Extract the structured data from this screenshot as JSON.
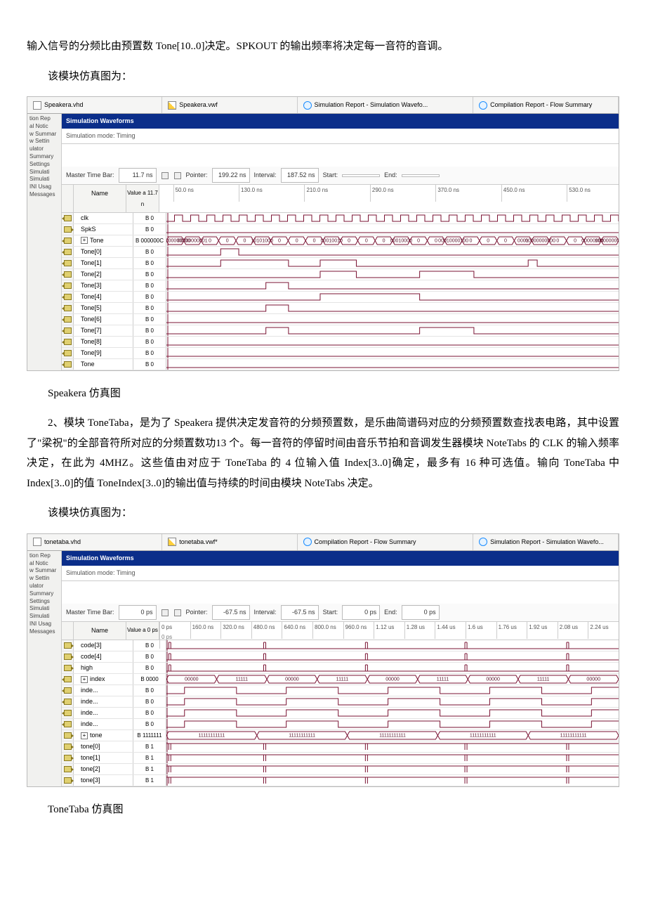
{
  "para1": "输入信号的分频比由预置数 Tone[10..0]决定。SPKOUT 的输出频率将决定每一音符的音调。",
  "para2": "该模块仿真图为：",
  "caption1": "Speakera 仿真图",
  "para3": "2、模块 ToneTaba，是为了 Speakera 提供决定发音符的分频预置数，是乐曲简谱码对应的分频预置数查找表电路，其中设置了\"梁祝\"的全部音符所对应的分频置数功13 个。每一音符的停留时间由音乐节拍和音调发生器模块 NoteTabs 的 CLK 的输入频率决定，在此为 4MHZ。这些值由对应于 ToneTaba 的 4 位输入值 Index[3..0]确定，最多有 16 种可选值。输向 ToneTaba 中 Index[3..0]的值 ToneIndex[3..0]的输出值与持续的时间由模块 NoteTabs 决定。",
  "para4": "该模块仿真图为：",
  "caption2": "ToneTaba 仿真图",
  "sim1": {
    "tabs": [
      "Speakera.vhd",
      "Speakera.vwf",
      "Simulation Report - Simulation Wavefo...",
      "Compilation Report - Flow Summary"
    ],
    "title": "Simulation Waveforms",
    "mode": "Simulation mode: Timing",
    "left": [
      "tion Rep",
      "al Notic",
      "w Summar",
      "w Settin",
      "ulator",
      "Summary",
      "Settings",
      "Simulati",
      "Simulati",
      "INI Usag",
      "Messages"
    ],
    "ruler": {
      "mtb": "Master Time Bar:",
      "mtb_v": "11.7 ns",
      "ptr": "Pointer:",
      "ptr_v": "199.22 ns",
      "int": "Interval:",
      "int_v": "187.52 ns",
      "st": "Start:",
      "st_v": "",
      "en": "End:",
      "en_v": ""
    },
    "nmhdr": "Name",
    "valhdr": "Value a\n11.7 n",
    "ticks": [
      "50.0 ns",
      "130.0 ns",
      "210.0 ns",
      "290.0 ns",
      "370.0 ns",
      "450.0 ns",
      "530.0 ns"
    ],
    "rows": [
      {
        "ic": "in",
        "name": "clk",
        "val": "B 0"
      },
      {
        "ic": "out",
        "name": "SpkS",
        "val": "B 0"
      },
      {
        "ic": "in",
        "name": "Tone",
        "val": "B 000000C",
        "exp": true,
        "bus": [
          "00000000000",
          "00000000001",
          "0",
          "0",
          "0",
          "10101000",
          "0",
          "0",
          "0",
          "00010010",
          "0",
          "0",
          "0",
          "00010000",
          "0",
          "0",
          "00010000100",
          "0",
          "0",
          "0",
          "0001",
          "00000000000",
          "0",
          "0",
          "00000000",
          "10000000000"
        ]
      },
      {
        "ic": "in",
        "name": "Tone[0]",
        "val": "B 0"
      },
      {
        "ic": "in",
        "name": "Tone[1]",
        "val": "B 0"
      },
      {
        "ic": "in",
        "name": "Tone[2]",
        "val": "B 0"
      },
      {
        "ic": "in",
        "name": "Tone[3]",
        "val": "B 0"
      },
      {
        "ic": "in",
        "name": "Tone[4]",
        "val": "B 0"
      },
      {
        "ic": "in",
        "name": "Tone[5]",
        "val": "B 0"
      },
      {
        "ic": "in",
        "name": "Tone[6]",
        "val": "B 0"
      },
      {
        "ic": "in",
        "name": "Tone[7]",
        "val": "B 0"
      },
      {
        "ic": "in",
        "name": "Tone[8]",
        "val": "B 0"
      },
      {
        "ic": "in",
        "name": "Tone[9]",
        "val": "B 0"
      },
      {
        "ic": "in",
        "name": "Tone",
        "val": "B 0"
      }
    ]
  },
  "sim2": {
    "tabs": [
      "tonetaba.vhd",
      "tonetaba.vwf*",
      "Compilation Report - Flow Summary",
      "Simulation Report - Simulation Wavefo..."
    ],
    "title": "Simulation Waveforms",
    "mode": "Simulation mode: Timing",
    "left": [
      "tion Rep",
      "al Notic",
      "w Summar",
      "w Settin",
      "ulator",
      "Summary",
      "Settings",
      "Simulati",
      "Simulati",
      "INI Usag",
      "Messages"
    ],
    "ruler": {
      "mtb": "Master Time Bar:",
      "mtb_v": "0 ps",
      "ptr": "Pointer:",
      "ptr_v": "-67.5 ns",
      "int": "Interval:",
      "int_v": "-67.5 ns",
      "st": "Start:",
      "st_v": "0 ps",
      "en": "End:",
      "en_v": "0 ps"
    },
    "nmhdr": "Name",
    "valhdr": "Value a\n0 ps",
    "topticks": [
      "0 ps",
      "160.0 ns",
      "320.0 ns",
      "480.0 ns",
      "640.0 ns",
      "800.0 ns",
      "960.0 ns",
      "1.12 us",
      "1.28 us",
      "1.44 us",
      "1.6 us",
      "1.76 us",
      "1.92 us",
      "2.08 us",
      "2.24 us"
    ],
    "zerotick": "0 ps",
    "rows": [
      {
        "ic": "out",
        "name": "code[3]",
        "val": "B 0"
      },
      {
        "ic": "out",
        "name": "code[4]",
        "val": "B 0"
      },
      {
        "ic": "out",
        "name": "high",
        "val": "B 0"
      },
      {
        "ic": "in",
        "name": "index",
        "val": "B 0000",
        "exp": true,
        "bus": [
          "00000",
          "11111",
          "00000",
          "11111",
          "00000",
          "11111",
          "00000",
          "11111",
          "00000"
        ]
      },
      {
        "ic": "in",
        "name": "inde...",
        "val": "B 0"
      },
      {
        "ic": "in",
        "name": "inde...",
        "val": "B 0"
      },
      {
        "ic": "in",
        "name": "inde...",
        "val": "B 0"
      },
      {
        "ic": "in",
        "name": "inde...",
        "val": "B 0"
      },
      {
        "ic": "out",
        "name": "tone",
        "val": "B 1111111",
        "exp": true,
        "bus": [
          "11111111111",
          "11111111111",
          "11111111111",
          "11111111111",
          "11111111111"
        ]
      },
      {
        "ic": "out",
        "name": "tone[0]",
        "val": "B 1"
      },
      {
        "ic": "out",
        "name": "tone[1]",
        "val": "B 1"
      },
      {
        "ic": "out",
        "name": "tone[2]",
        "val": "B 1"
      },
      {
        "ic": "out",
        "name": "tone[3]",
        "val": "B 1"
      }
    ]
  }
}
